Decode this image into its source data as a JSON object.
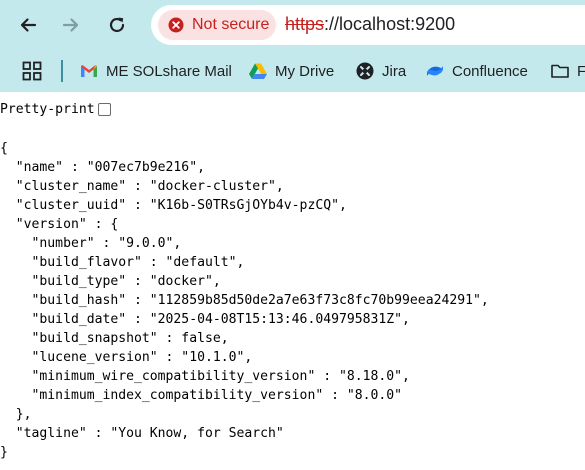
{
  "browser": {
    "security_label": "Not secure",
    "url_scheme": "https",
    "url_rest": "://localhost:9200"
  },
  "bookmarks": [
    {
      "label": "ME SOLshare Mail",
      "icon": "gmail-icon"
    },
    {
      "label": "My Drive",
      "icon": "google-drive-icon"
    },
    {
      "label": "Jira",
      "icon": "jira-icon"
    },
    {
      "label": "Confluence",
      "icon": "confluence-icon"
    },
    {
      "label": "F",
      "icon": "folder-icon"
    }
  ],
  "page": {
    "pretty_print_label": "Pretty-print",
    "pretty_print_checked": false,
    "json_lines": [
      "{",
      "  \"name\" : \"007ec7b9e216\",",
      "  \"cluster_name\" : \"docker-cluster\",",
      "  \"cluster_uuid\" : \"K16b-S0TRsGjOYb4v-pzCQ\",",
      "  \"version\" : {",
      "    \"number\" : \"9.0.0\",",
      "    \"build_flavor\" : \"default\",",
      "    \"build_type\" : \"docker\",",
      "    \"build_hash\" : \"112859b85d50de2a7e63f73c8fc70b99eea24291\",",
      "    \"build_date\" : \"2025-04-08T15:13:46.049795831Z\",",
      "    \"build_snapshot\" : false,",
      "    \"lucene_version\" : \"10.1.0\",",
      "    \"minimum_wire_compatibility_version\" : \"8.18.0\",",
      "    \"minimum_index_compatibility_version\" : \"8.0.0\"",
      "  },",
      "  \"tagline\" : \"You Know, for Search\"",
      "}"
    ]
  }
}
